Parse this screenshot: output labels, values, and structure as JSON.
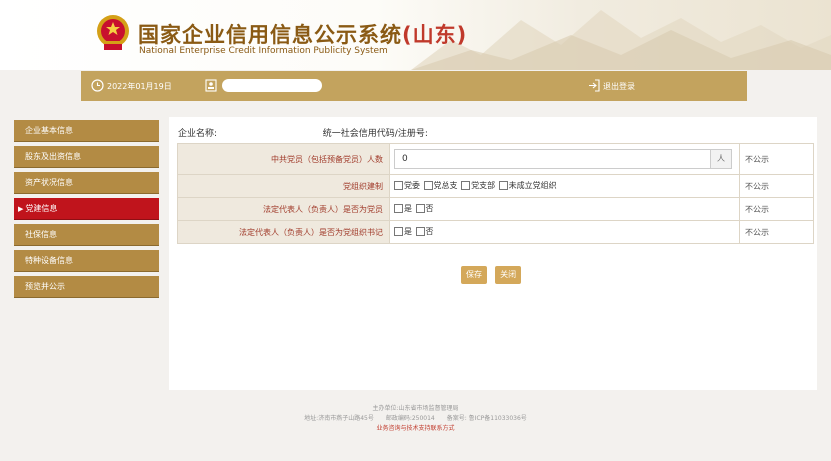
{
  "header": {
    "title_cn": "国家企业信用信息公示系统",
    "title_province": "(山东)",
    "title_en": "National Enterprise Credit Information Publicity System"
  },
  "topbar": {
    "date": "2022年01月19日",
    "logout_label": "退出登录"
  },
  "sidebar": {
    "items": [
      {
        "label": "企业基本信息"
      },
      {
        "label": "股东及出资信息"
      },
      {
        "label": "资产状况信息"
      },
      {
        "label": "党建信息",
        "active": true,
        "marker": "▶"
      },
      {
        "label": "社保信息"
      },
      {
        "label": "特种设备信息"
      },
      {
        "label": "预览并公示"
      }
    ]
  },
  "main": {
    "company_name_label": "企业名称:",
    "credit_code_label": "统一社会信用代码/注册号:",
    "rows": [
      {
        "label": "中共党员（包括预备党员）人数",
        "value": "0",
        "unit": "人",
        "publicity": "不公示"
      },
      {
        "label": "党组织建制",
        "options": [
          "党委",
          "党总支",
          "党支部",
          "未成立党组织"
        ],
        "publicity": "不公示"
      },
      {
        "label": "法定代表人（负责人）是否为党员",
        "options": [
          "是",
          "否"
        ],
        "publicity": "不公示"
      },
      {
        "label": "法定代表人（负责人）是否为党组织书记",
        "options": [
          "是",
          "否"
        ],
        "publicity": "不公示"
      }
    ],
    "save_label": "保存",
    "close_label": "关闭"
  },
  "footer": {
    "line1": "主办单位:山东省市场监督管理局",
    "line2": "地址:济南市燕子山路45号　　邮政编码:250014　　备案号: 鲁ICP备11033036号",
    "line3": "业务咨询与技术支持联系方式"
  },
  "colors": {
    "gold": "#b38b44",
    "topbar": "#c3a35e",
    "active_red": "#c0141c",
    "label_red": "#a03a2a"
  }
}
